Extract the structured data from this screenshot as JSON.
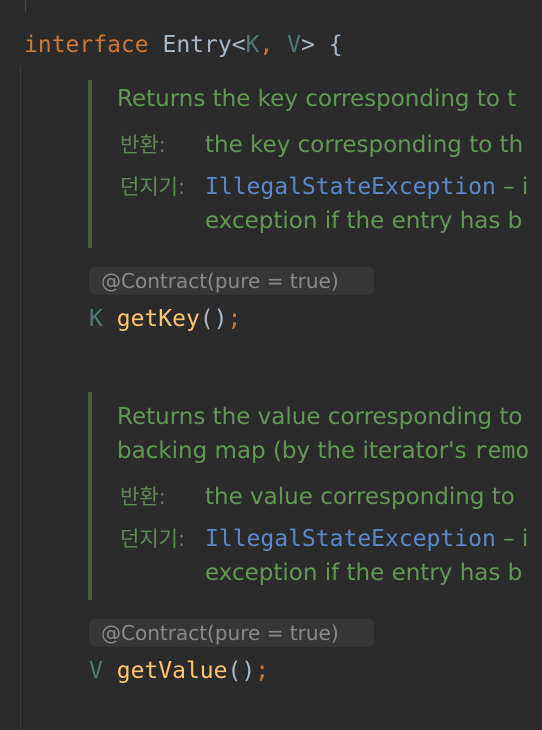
{
  "interface_decl": {
    "keyword": "interface",
    "name": "Entry",
    "open_angle": "<",
    "type_param_k": "K",
    "comma": ", ",
    "type_param_v": "V",
    "close_angle": ">",
    "brace": " {"
  },
  "getKey_doc": {
    "summary": "Returns the key corresponding to t",
    "returns_label": "반환:",
    "returns_text": "the key corresponding to th",
    "throws_label": "던지기:",
    "throws_exception": "IllegalStateException",
    "throws_dash": " – i",
    "throws_text_2": "exception if the entry has b"
  },
  "getKey_annotation": "@Contract(pure = true)",
  "getKey_sig": {
    "return_type": "K",
    "method": "getKey",
    "parens": "()",
    "semicolon": ";"
  },
  "getValue_doc": {
    "summary_1": "Returns the value corresponding to",
    "summary_2_text": "backing map (by the iterator's ",
    "summary_2_code": "remo",
    "returns_label": "반환:",
    "returns_text": "the value corresponding to",
    "throws_label": "던지기:",
    "throws_exception": "IllegalStateException",
    "throws_dash": " – i",
    "throws_text_2": "exception if the entry has b"
  },
  "getValue_annotation": "@Contract(pure = true)",
  "getValue_sig": {
    "return_type": "V",
    "method": "getValue",
    "parens": "()",
    "semicolon": ";"
  }
}
